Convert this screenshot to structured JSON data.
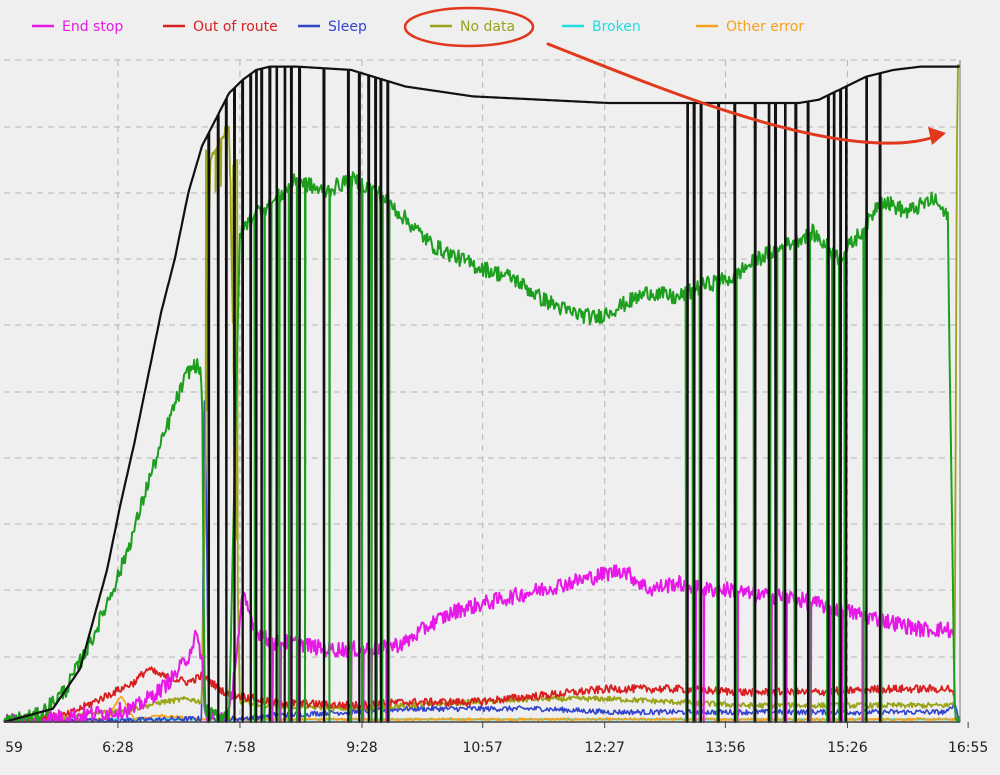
{
  "chart_data": {
    "type": "line",
    "title": "",
    "xlabel": "",
    "ylabel": "",
    "x_unit": "time of day",
    "x_ticks": [
      "59",
      "6:28",
      "7:58",
      "9:28",
      "10:57",
      "12:27",
      "13:56",
      "15:26",
      "16:55"
    ],
    "x_tick_minutes": [
      299,
      388,
      478,
      568,
      657,
      747,
      836,
      926,
      1015
    ],
    "xlim_minutes": [
      304,
      1009
    ],
    "ylim": [
      0,
      1
    ],
    "y_note": "vertical scale is unlabeled; values are relative heights (0 = baseline, 1 = top of plot)",
    "grid": true,
    "legend_position": "top",
    "legend": [
      {
        "name": "End stop",
        "color": "#e619e6"
      },
      {
        "name": "Out of route",
        "color": "#d92020"
      },
      {
        "name": "Sleep",
        "color": "#3344cc"
      },
      {
        "name": "No data",
        "color": "#9aa31a"
      },
      {
        "name": "Broken",
        "color": "#22dddd"
      },
      {
        "name": "Other error",
        "color": "#f5a21a"
      }
    ],
    "total_color": "#111111",
    "active_color": "#1e9e1e",
    "annotation": {
      "circle_target": "No data",
      "arrow_color": "#e0391e"
    },
    "series": [
      {
        "key": "total",
        "color": "#111111",
        "x": [
          304,
          340,
          360,
          380,
          390,
          400,
          410,
          420,
          430,
          440,
          450,
          460,
          470,
          480,
          490,
          500,
          520,
          560,
          600,
          650,
          700,
          750,
          800,
          830,
          860,
          890,
          905,
          920,
          940,
          960,
          980,
          1000,
          1009
        ],
        "y": [
          0,
          0.02,
          0.08,
          0.23,
          0.33,
          0.42,
          0.52,
          0.62,
          0.7,
          0.8,
          0.87,
          0.91,
          0.95,
          0.97,
          0.985,
          0.99,
          0.99,
          0.985,
          0.96,
          0.945,
          0.94,
          0.935,
          0.935,
          0.935,
          0.935,
          0.935,
          0.94,
          0.955,
          0.975,
          0.985,
          0.99,
          0.99,
          0.99
        ],
        "dips": [
          455,
          462,
          468,
          474,
          480,
          486,
          490,
          494,
          500,
          505,
          511,
          516,
          522,
          540,
          558,
          566,
          573,
          578,
          582,
          587,
          808,
          813,
          818,
          831,
          843,
          858,
          868,
          873,
          880,
          888,
          897,
          912,
          916,
          921,
          925,
          940,
          950
        ],
        "noise": 0
      },
      {
        "key": "active",
        "color": "#1e9e1e",
        "x": [
          304,
          330,
          350,
          370,
          380,
          390,
          400,
          410,
          420,
          430,
          440,
          446,
          450,
          452,
          456,
          470,
          478,
          490,
          500,
          510,
          520,
          540,
          560,
          570,
          580,
          600,
          620,
          650,
          680,
          700,
          720,
          740,
          760,
          780,
          800,
          820,
          840,
          860,
          880,
          900,
          920,
          940,
          950,
          970,
          990,
          1000,
          1005,
          1009
        ],
        "y": [
          0,
          0.01,
          0.05,
          0.13,
          0.18,
          0.23,
          0.29,
          0.36,
          0.42,
          0.48,
          0.53,
          0.54,
          0.52,
          0.02,
          0.01,
          0.01,
          0.74,
          0.77,
          0.78,
          0.8,
          0.82,
          0.8,
          0.82,
          0.81,
          0.8,
          0.76,
          0.72,
          0.69,
          0.67,
          0.64,
          0.62,
          0.61,
          0.63,
          0.65,
          0.64,
          0.66,
          0.67,
          0.7,
          0.72,
          0.74,
          0.7,
          0.75,
          0.79,
          0.77,
          0.79,
          0.76,
          0.02,
          0
        ],
        "dips": [
          489,
          496,
          501,
          507,
          514,
          520,
          526,
          544,
          560,
          568,
          575,
          579,
          583,
          588,
          807,
          812,
          817,
          830,
          844,
          857,
          869,
          874,
          879,
          887,
          898,
          911,
          915,
          920,
          924,
          938,
          951
        ],
        "noise": 0.012
      },
      {
        "key": "end_stop",
        "color": "#e619e6",
        "x": [
          304,
          360,
          400,
          420,
          430,
          440,
          445,
          450,
          452,
          470,
          478,
          480,
          490,
          500,
          520,
          540,
          560,
          580,
          600,
          620,
          640,
          660,
          680,
          700,
          720,
          740,
          760,
          780,
          800,
          820,
          840,
          860,
          880,
          900,
          920,
          940,
          960,
          980,
          1000,
          1005
        ],
        "y": [
          0,
          0.01,
          0.02,
          0.05,
          0.07,
          0.1,
          0.13,
          0.1,
          0.01,
          0.01,
          0.15,
          0.19,
          0.14,
          0.12,
          0.12,
          0.11,
          0.11,
          0.11,
          0.12,
          0.15,
          0.17,
          0.18,
          0.19,
          0.2,
          0.21,
          0.22,
          0.23,
          0.2,
          0.21,
          0.2,
          0.2,
          0.19,
          0.19,
          0.18,
          0.17,
          0.16,
          0.15,
          0.14,
          0.14,
          0.13
        ],
        "dips": [
          489,
          496,
          502,
          508,
          515,
          521,
          560,
          569,
          575,
          582,
          586,
          808,
          814,
          820,
          845,
          870,
          881,
          888,
          899,
          913,
          922,
          937
        ],
        "noise": 0.012
      },
      {
        "key": "out_of_route",
        "color": "#d92020",
        "x": [
          304,
          350,
          380,
          400,
          410,
          420,
          440,
          450,
          470,
          478,
          500,
          560,
          600,
          650,
          700,
          750,
          800,
          850,
          900,
          950,
          1000,
          1005
        ],
        "y": [
          0,
          0.01,
          0.04,
          0.06,
          0.08,
          0.07,
          0.06,
          0.07,
          0.04,
          0.04,
          0.03,
          0.025,
          0.03,
          0.03,
          0.04,
          0.05,
          0.05,
          0.045,
          0.045,
          0.05,
          0.05,
          0.04
        ],
        "noise": 0.006
      },
      {
        "key": "no_data",
        "color": "#9aa31a",
        "x": [
          304,
          360,
          400,
          420,
          440,
          450,
          456,
          470,
          478,
          500,
          560,
          600,
          650,
          700,
          750,
          800,
          850,
          900,
          950,
          1000,
          1005,
          1007,
          1009
        ],
        "y": [
          0,
          0.01,
          0.02,
          0.03,
          0.035,
          0.03,
          0.85,
          0.9,
          0.03,
          0.025,
          0.02,
          0.025,
          0.03,
          0.035,
          0.035,
          0.03,
          0.025,
          0.025,
          0.025,
          0.025,
          0.03,
          0.99,
          0.99
        ],
        "spikes": [
          453,
          460,
          464,
          467,
          471,
          473,
          476
        ],
        "noise": 0.004
      },
      {
        "key": "sleep",
        "color": "#3344cc",
        "x": [
          304,
          400,
          450,
          452,
          455,
          470,
          478,
          500,
          560,
          600,
          650,
          700,
          750,
          800,
          850,
          900,
          950,
          1000,
          1005,
          1009
        ],
        "y": [
          0,
          0.003,
          0.005,
          0.55,
          0.005,
          0.005,
          0.005,
          0.01,
          0.015,
          0.02,
          0.02,
          0.02,
          0.015,
          0.015,
          0.015,
          0.015,
          0.015,
          0.015,
          0.03,
          0
        ],
        "noise": 0.004
      },
      {
        "key": "broken",
        "color": "#22dddd",
        "x": [
          304,
          1009
        ],
        "y": [
          0.004,
          0.004
        ],
        "noise": 0
      },
      {
        "key": "other_error",
        "color": "#f5a21a",
        "x": [
          304,
          380,
          390,
          400,
          420,
          450,
          1009
        ],
        "y": [
          0,
          0.004,
          0.04,
          0.004,
          0.01,
          0.004,
          0.004
        ],
        "noise": 0.002
      }
    ]
  }
}
